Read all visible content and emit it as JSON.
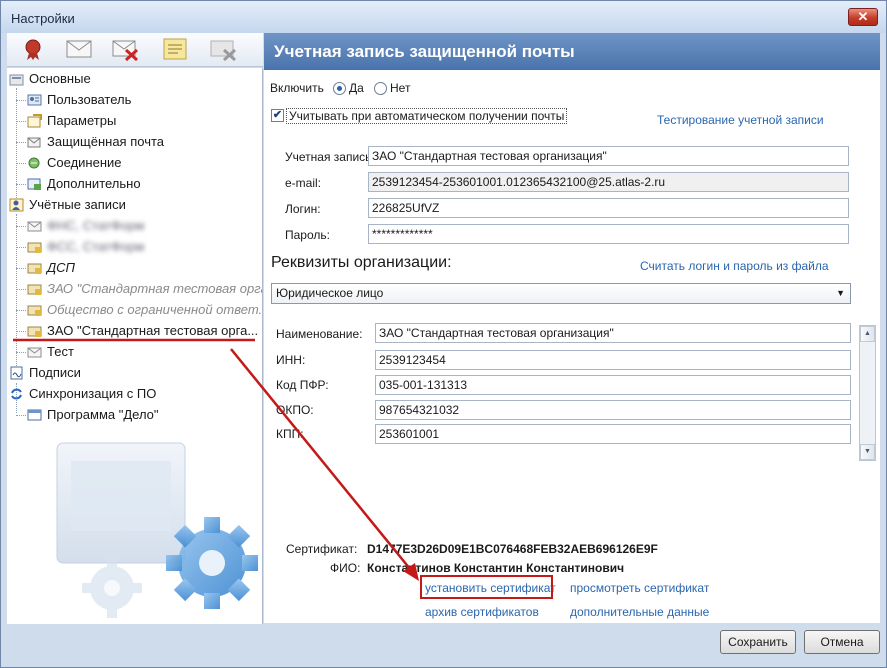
{
  "window": {
    "title": "Настройки",
    "close_glyph": "✕"
  },
  "toolbar": {
    "icons": [
      "seal-icon",
      "envelope-icon",
      "envelope-delete-icon",
      "note-icon",
      "disabled-icon"
    ]
  },
  "tree": {
    "items": [
      {
        "label": "Основные",
        "icon": "folder-icon"
      },
      {
        "label": "Пользователь",
        "icon": "user-card-icon"
      },
      {
        "label": "Параметры",
        "icon": "settings-icon"
      },
      {
        "label": "Защищённая почта",
        "icon": "mail-icon"
      },
      {
        "label": "Соединение",
        "icon": "connection-icon"
      },
      {
        "label": "Дополнительно",
        "icon": "extra-icon"
      },
      {
        "label": "Учётные записи",
        "icon": "accounts-icon"
      },
      {
        "label": "ФНС, СтатФорм",
        "icon": "envelope-icon"
      },
      {
        "label": "ФСС, СтатФорм",
        "icon": "envelope-icon"
      },
      {
        "label": "ДСП",
        "icon": "envelope-icon"
      },
      {
        "label": "ЗАО \"Стандартная тестовая орга...",
        "icon": "envelope-icon"
      },
      {
        "label": "Общество с ограниченной ответ...",
        "icon": "envelope-icon"
      },
      {
        "label": "ЗАО \"Стандартная тестовая орга...",
        "icon": "envelope-icon"
      },
      {
        "label": "Тест",
        "icon": "envelope-icon"
      },
      {
        "label": "Подписи",
        "icon": "signature-icon"
      },
      {
        "label": "Синхронизация с ПО",
        "icon": "sync-icon"
      },
      {
        "label": "Программа \"Дело\"",
        "icon": "window-icon"
      }
    ]
  },
  "header": {
    "title": "Учетная запись защищенной почты"
  },
  "enable": {
    "label": "Включить",
    "yes": "Да",
    "no": "Нет",
    "selected": "Да"
  },
  "auto_receive": {
    "label": "Учитывать при автоматическом получении почты",
    "checked": true,
    "check_glyph": "✔"
  },
  "test_link": "Тестирование учетной записи",
  "account": {
    "account_label": "Учетная запись:",
    "account_value": "ЗАО \"Стандартная тестовая организация\"",
    "email_label": "e-mail:",
    "email_value": "2539123454-253601001.012365432100@25.atlas-2.ru",
    "login_label": "Логин:",
    "login_value": "226825UfVZ",
    "password_label": "Пароль:",
    "password_value": "*************"
  },
  "org": {
    "section_title": "Реквизиты организации:",
    "read_link": "Считать логин и пароль из файла",
    "type_value": "Юридическое лицо",
    "name_label": "Наименование:",
    "name_value": "ЗАО \"Стандартная тестовая организация\"",
    "inn_label": "ИНН:",
    "inn_value": "2539123454",
    "pfr_label": "Код ПФР:",
    "pfr_value": "035-001-131313",
    "okpo_label": "ОКПО:",
    "okpo_value": "987654321032",
    "kpp_label": "КПП:",
    "kpp_value": "253601001"
  },
  "certificate": {
    "cert_label": "Сертификат:",
    "cert_value": "D1477E3D26D09E1BC076468FEB32AEB696126E9F",
    "fio_label": "ФИО:",
    "fio_value": "Константинов Константин Константинович",
    "install_link": "установить сертификат",
    "view_link": "просмотреть сертификат",
    "archive_link": "архив сертификатов",
    "extra_link": "дополнительные данные"
  },
  "buttons": {
    "save": "Сохранить",
    "cancel": "Отмена"
  },
  "colors": {
    "header": "#4a73ac",
    "link": "#2a66b0",
    "annotation": "#c41919"
  }
}
